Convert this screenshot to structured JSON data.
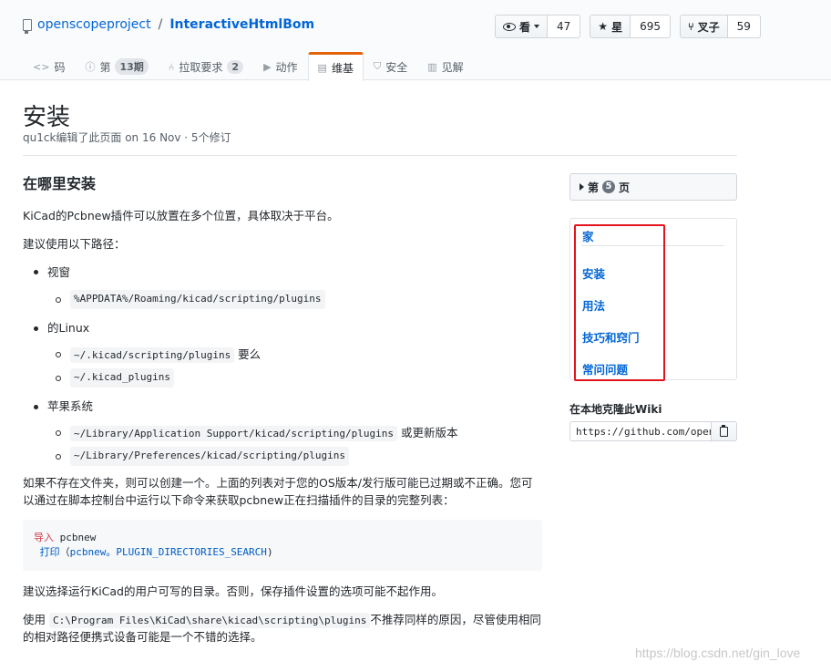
{
  "repo": {
    "owner": "openscopeproject",
    "separator": "/",
    "name": "InteractiveHtmlBom"
  },
  "actions": [
    {
      "label": "看",
      "count": "47"
    },
    {
      "label": "星",
      "count": "695"
    },
    {
      "label": "叉子",
      "count": "59"
    }
  ],
  "nav": {
    "code": "码",
    "issues": "第",
    "issues_count": "13期",
    "pulls": "拉取要求",
    "pulls_count": "2",
    "actions": "动作",
    "wiki": "维基",
    "security": "安全",
    "insights": "见解"
  },
  "page": {
    "title": "安装",
    "meta": "qu1ck编辑了此页面 on 16 Nov · 5个修订"
  },
  "content": {
    "heading": "在哪里安装",
    "p1": "KiCad的Pcbnew插件可以放置在多个位置，具体取决于平台。",
    "p2": "建议使用以下路径：",
    "os1": "视窗",
    "os1_path1": "%APPDATA%/Roaming/kicad/scripting/plugins",
    "os2": "的Linux",
    "os2_path1": "~/.kicad/scripting/plugins",
    "os2_or": "要么",
    "os2_path2": "~/.kicad_plugins",
    "os3": "苹果系统",
    "os3_path1": "~/Library/Application Support/kicad/scripting/plugins",
    "os3_note": "或更新版本",
    "os3_path2": "~/Library/Preferences/kicad/scripting/plugins",
    "p3": "如果不存在文件夹，则可以创建一个。上面的列表对于您的OS版本/发行版可能已过期或不正确。您可以通过在脚本控制台中运行以下命令来获取pcbnew正在扫描插件的目录的完整列表：",
    "code_kw": "导入",
    "code_mod": "pcbnew",
    "code_print": "打印",
    "code_open": "（",
    "code_call": "pcbnew。PLUGIN_DIRECTORIES_SEARCH",
    "code_close": ")",
    "p4": "建议选择运行KiCad的用户可写的目录。否则，保存插件设置的选项可能不起作用。",
    "p5_pre": "使用",
    "p5_code": "C:\\Program Files\\KiCad\\share\\kicad\\scripting\\plugins",
    "p5_post": "不推荐同样的原因，尽管使用相同的相对路径便携式设备可能是一个不错的选择。"
  },
  "sidebar": {
    "pages_label_pre": "第",
    "pages_count": "5",
    "pages_label_post": "页",
    "toc": [
      "家",
      "安装",
      "用法",
      "技巧和窍门",
      "常问问题"
    ],
    "clone_title": "在本地克隆此Wiki",
    "clone_url": "https://github.com/openscopeproject/InteractiveHtmlBom.wiki.git"
  },
  "watermark": "https://blog.csdn.net/gin_love",
  "colors": {
    "accent": "#e36209",
    "link": "#0366d6",
    "highlight": "#e3141e"
  }
}
